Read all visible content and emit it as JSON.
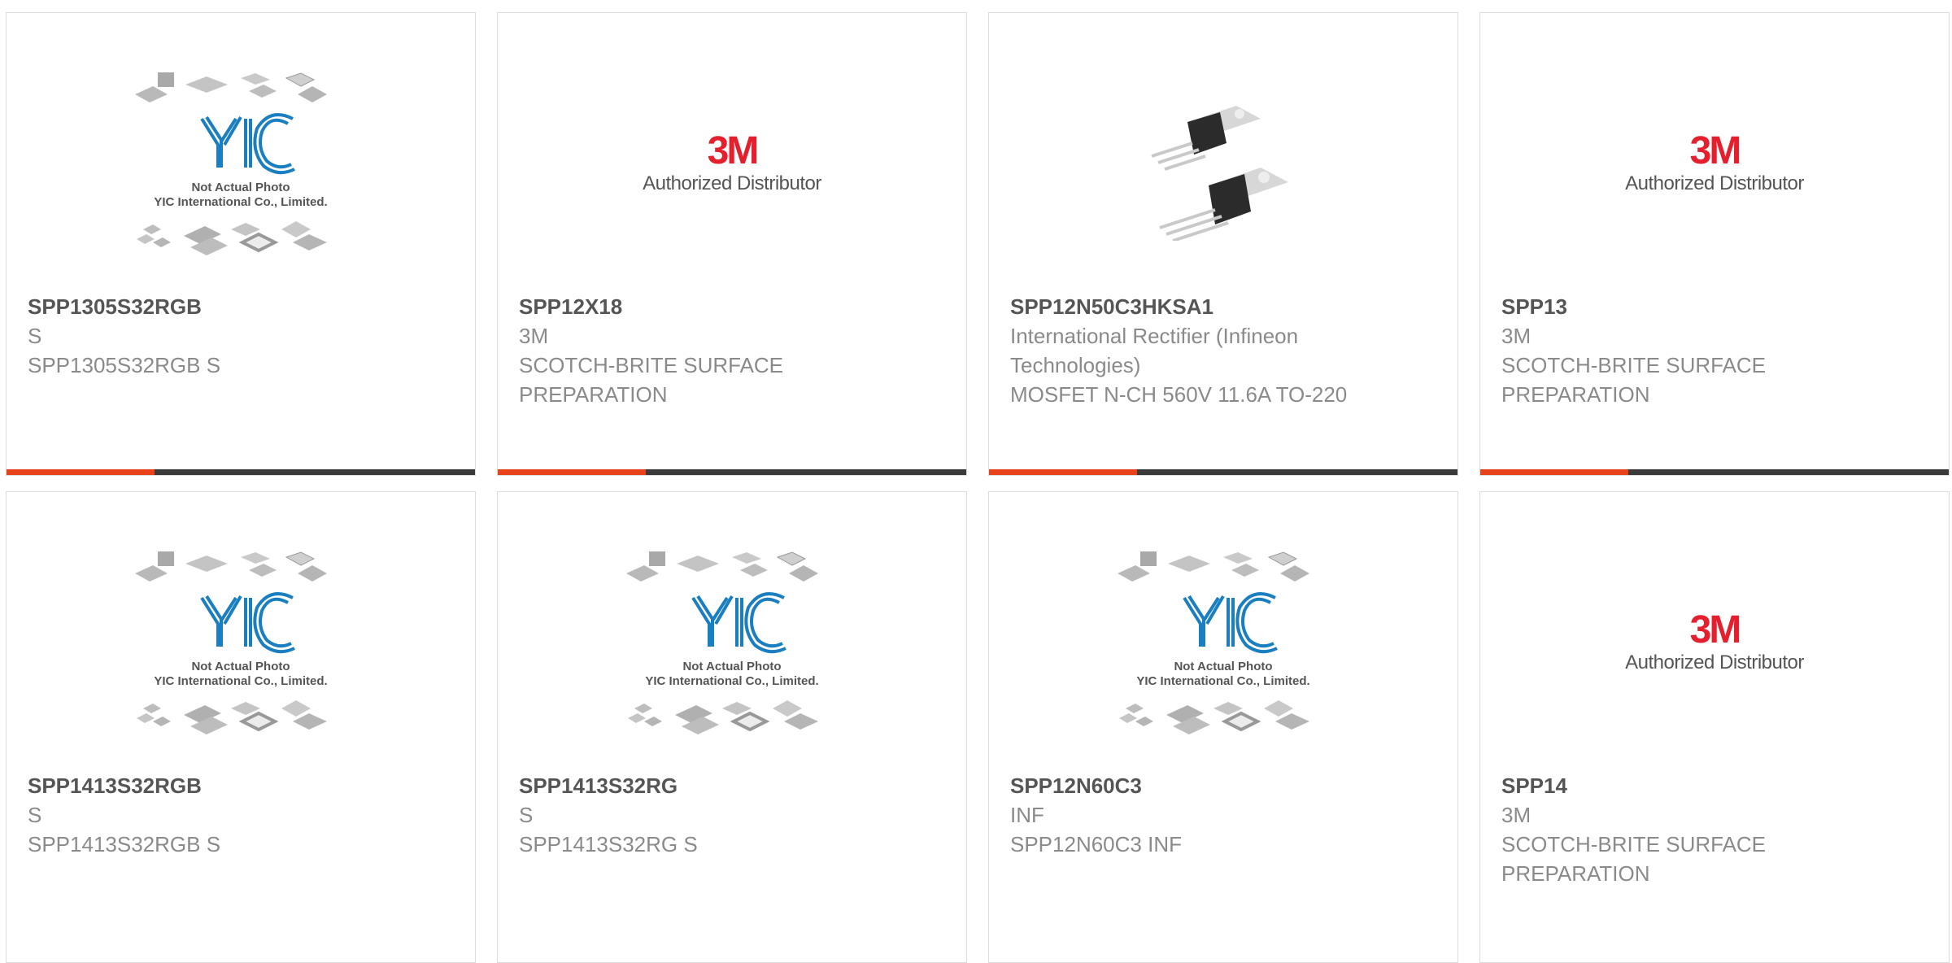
{
  "colors": {
    "accent": "#e8421a",
    "bar_dark": "#3a3a3a",
    "brand_3m": "#e4202e",
    "yic_blue": "#1a7fc0"
  },
  "placeholder": {
    "line1": "Not Actual Photo",
    "line2": "YIC International Co., Limited.",
    "logo": "YIC"
  },
  "logo_3m": {
    "mark": "3M",
    "tagline": "Authorized Distributor"
  },
  "products": [
    {
      "part_number": "SPP1305S32RGB",
      "manufacturer": "S",
      "description": "SPP1305S32RGB S",
      "image": "placeholder"
    },
    {
      "part_number": "SPP12X18",
      "manufacturer": "3M",
      "description": "SCOTCH-BRITE SURFACE PREPARATION",
      "image": "3m"
    },
    {
      "part_number": "SPP12N50C3HKSA1",
      "manufacturer": "International Rectifier (Infineon Technologies)",
      "description": "MOSFET N-CH 560V 11.6A TO-220",
      "image": "to220"
    },
    {
      "part_number": "SPP13",
      "manufacturer": "3M",
      "description": "SCOTCH-BRITE SURFACE PREPARATION",
      "image": "3m"
    },
    {
      "part_number": "SPP1413S32RGB",
      "manufacturer": "S",
      "description": "SPP1413S32RGB S",
      "image": "placeholder"
    },
    {
      "part_number": "SPP1413S32RG",
      "manufacturer": "S",
      "description": "SPP1413S32RG S",
      "image": "placeholder"
    },
    {
      "part_number": "SPP12N60C3",
      "manufacturer": "INF",
      "description": "SPP12N60C3 INF",
      "image": "placeholder"
    },
    {
      "part_number": "SPP14",
      "manufacturer": "3M",
      "description": "SCOTCH-BRITE SURFACE PREPARATION",
      "image": "3m"
    }
  ]
}
